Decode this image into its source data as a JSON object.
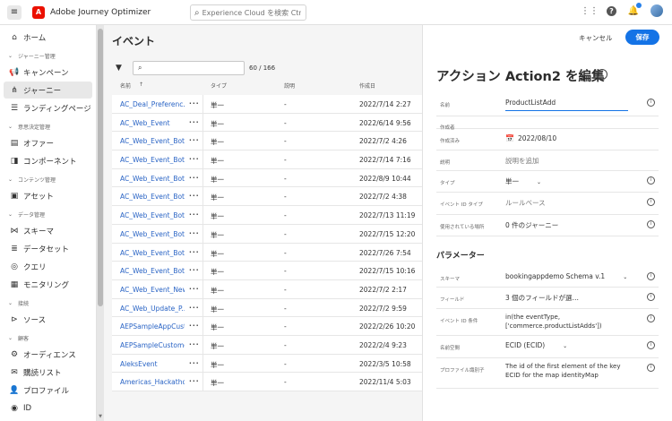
{
  "app": {
    "title": "Adobe Journey Optimizer",
    "search_placeholder": "Experience Cloud を検索 Ctr..."
  },
  "sidebar": {
    "items": [
      {
        "type": "item",
        "label": "ホーム",
        "icon": "home-icon",
        "glyph": "⌂"
      },
      {
        "type": "section",
        "label": "ジャーニー管理"
      },
      {
        "type": "item",
        "label": "キャンペーン",
        "icon": "megaphone-icon",
        "glyph": "📢"
      },
      {
        "type": "item",
        "label": "ジャーニー",
        "icon": "journey-icon",
        "glyph": "⋔",
        "active": true
      },
      {
        "type": "item",
        "label": "ランディングページ",
        "icon": "landing-page-icon",
        "glyph": "☰"
      },
      {
        "type": "section",
        "label": "意思決定管理"
      },
      {
        "type": "item",
        "label": "オファー",
        "icon": "offer-icon",
        "glyph": "▤"
      },
      {
        "type": "item",
        "label": "コンポーネント",
        "icon": "component-icon",
        "glyph": "◨"
      },
      {
        "type": "section",
        "label": "コンテンツ管理"
      },
      {
        "type": "item",
        "label": "アセット",
        "icon": "asset-icon",
        "glyph": "▣"
      },
      {
        "type": "section",
        "label": "データ管理"
      },
      {
        "type": "item",
        "label": "スキーマ",
        "icon": "schema-icon",
        "glyph": "⋈"
      },
      {
        "type": "item",
        "label": "データセット",
        "icon": "dataset-icon",
        "glyph": "≣"
      },
      {
        "type": "item",
        "label": "クエリ",
        "icon": "query-icon",
        "glyph": "◎"
      },
      {
        "type": "item",
        "label": "モニタリング",
        "icon": "monitoring-icon",
        "glyph": "▦"
      },
      {
        "type": "section",
        "label": "接続"
      },
      {
        "type": "item",
        "label": "ソース",
        "icon": "source-icon",
        "glyph": "⊳"
      },
      {
        "type": "section",
        "label": "顧客"
      },
      {
        "type": "item",
        "label": "オーディエンス",
        "icon": "audience-icon",
        "glyph": "⚙"
      },
      {
        "type": "item",
        "label": "購読リスト",
        "icon": "subscription-list-icon",
        "glyph": "✉"
      },
      {
        "type": "item",
        "label": "プロファイル",
        "icon": "profile-icon",
        "glyph": "👤"
      },
      {
        "type": "item",
        "label": "ID",
        "icon": "identity-icon",
        "glyph": "◉"
      }
    ]
  },
  "list": {
    "title": "イベント",
    "count": "60 / 166",
    "columns": {
      "name": "名前",
      "sort": "↑",
      "type": "タイプ",
      "desc": "説明",
      "created": "作成日"
    },
    "rows": [
      {
        "name": "AC_Deal_Preferenc...",
        "type": "単一",
        "desc": "-",
        "created": "2022/7/14 2:27"
      },
      {
        "name": "AC_Web_Event",
        "type": "単一",
        "desc": "-",
        "created": "2022/6/14 9:56"
      },
      {
        "name": "AC_Web_Event_BotA",
        "type": "単一",
        "desc": "-",
        "created": "2022/7/2 4:26"
      },
      {
        "name": "AC_Web_Event_Bot...",
        "type": "単一",
        "desc": "-",
        "created": "2022/7/14 7:16"
      },
      {
        "name": "AC_Web_Event_Bot...",
        "type": "単一",
        "desc": "-",
        "created": "2022/8/9 10:44"
      },
      {
        "name": "AC_Web_Event_Bot...",
        "type": "単一",
        "desc": "-",
        "created": "2022/7/2 4:38"
      },
      {
        "name": "AC_Web_Event_Bot...",
        "type": "単一",
        "desc": "-",
        "created": "2022/7/13 11:19"
      },
      {
        "name": "AC_Web_Event_Bot...",
        "type": "単一",
        "desc": "-",
        "created": "2022/7/15 12:20"
      },
      {
        "name": "AC_Web_Event_Bot...",
        "type": "単一",
        "desc": "-",
        "created": "2022/7/26 7:54"
      },
      {
        "name": "AC_Web_Event_Bot...",
        "type": "単一",
        "desc": "-",
        "created": "2022/7/15 10:16"
      },
      {
        "name": "AC_Web_Event_New",
        "type": "単一",
        "desc": "-",
        "created": "2022/7/2 2:17"
      },
      {
        "name": "AC_Web_Update_P...",
        "type": "単一",
        "desc": "-",
        "created": "2022/7/2 9:59"
      },
      {
        "name": "AEPSampleAppCust...",
        "type": "単一",
        "desc": "-",
        "created": "2022/2/26 10:20"
      },
      {
        "name": "AEPSampleCustomo...",
        "type": "単一",
        "desc": "-",
        "created": "2022/2/4 9:23"
      },
      {
        "name": "AleksEvent",
        "type": "単一",
        "desc": "-",
        "created": "2022/3/5 10:58"
      },
      {
        "name": "Americas_Hackatho...",
        "type": "単一",
        "desc": "-",
        "created": "2022/11/4 5:03"
      }
    ]
  },
  "edit": {
    "cancel_label": "キャンセル",
    "save_label": "保存",
    "title": "アクション Action2 を編集",
    "fields": [
      {
        "label": "名前",
        "value": "ProductListAdd",
        "input": true,
        "info": true
      },
      {
        "label": "作成者",
        "value": ""
      },
      {
        "label": "作成済み",
        "value": "2022/08/10",
        "calendar": true
      },
      {
        "label": "説明",
        "value": "説明を追加",
        "gray": true
      },
      {
        "label": "タイプ",
        "value": "単一",
        "dropdown": true,
        "info": true
      },
      {
        "label": "イベント ID タイプ",
        "value": "ルールベース",
        "gray": true,
        "info": true
      },
      {
        "label": "使用されている場所",
        "value": "0 件のジャーニー",
        "info": true
      }
    ],
    "parameters_label": "パラメーター",
    "params": [
      {
        "label": "スキーマ",
        "value": "bookingappdemo Schema v.1",
        "dropdown": true,
        "info": true
      },
      {
        "label": "フィールド",
        "value": "3 個のフィールドが選…",
        "info": true
      },
      {
        "label": "イベント ID 条件",
        "value": "in(the eventType,",
        "value2": "['commerce.productListAdds'])",
        "info": true
      },
      {
        "label": "名前空間",
        "value": "ECID (ECID)",
        "dropdown": true,
        "info": true
      },
      {
        "label": "プロファイル識別子",
        "value": "The id of the first element of the key",
        "value2": "ECID for the map identityMap",
        "info": true
      }
    ]
  }
}
